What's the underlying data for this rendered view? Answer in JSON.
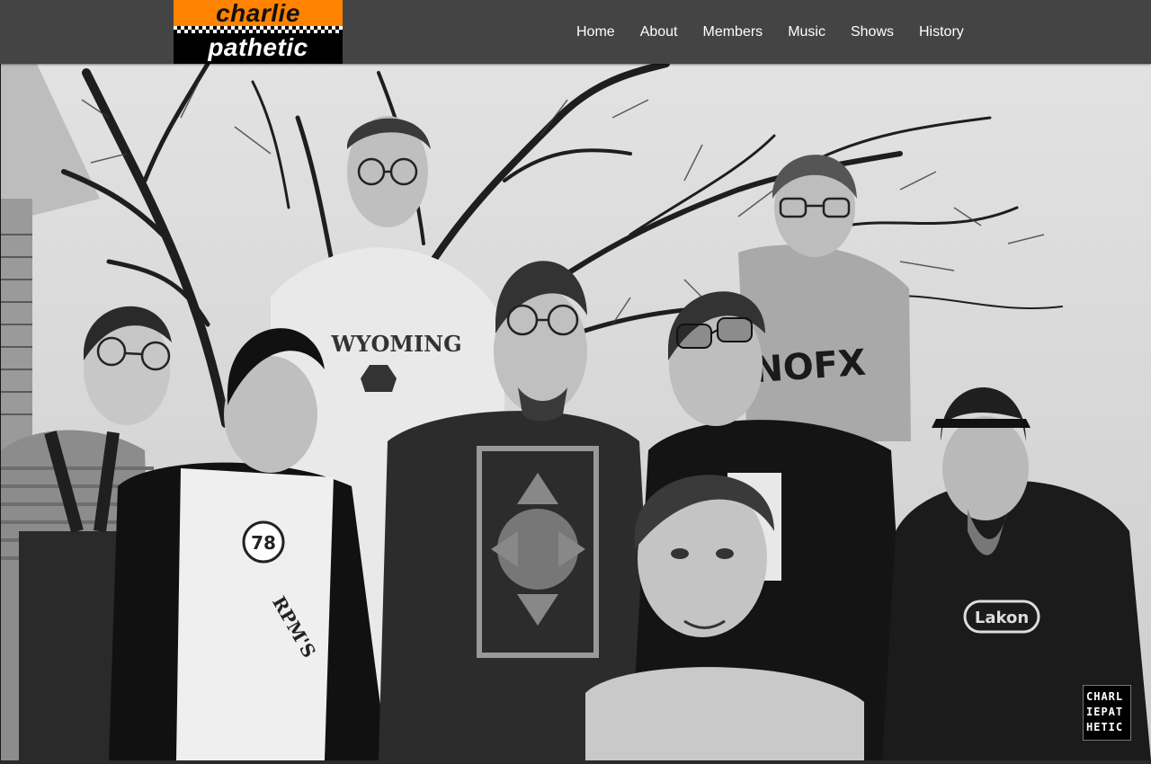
{
  "logo": {
    "line1": "charlie",
    "line2": "pathetic",
    "accent": "#ff8300"
  },
  "nav": {
    "items": [
      {
        "label": "Home"
      },
      {
        "label": "About"
      },
      {
        "label": "Members"
      },
      {
        "label": "Music"
      },
      {
        "label": "Shows"
      },
      {
        "label": "History"
      }
    ]
  },
  "hero": {
    "shirts": {
      "wyoming": "WYOMING",
      "nofx": "NOFX",
      "rpms_number": "78",
      "rpms_text": "RPM'S",
      "hoodie": "Lakon"
    },
    "watermark": "CHARL\nIEPAT\nHETIC"
  }
}
